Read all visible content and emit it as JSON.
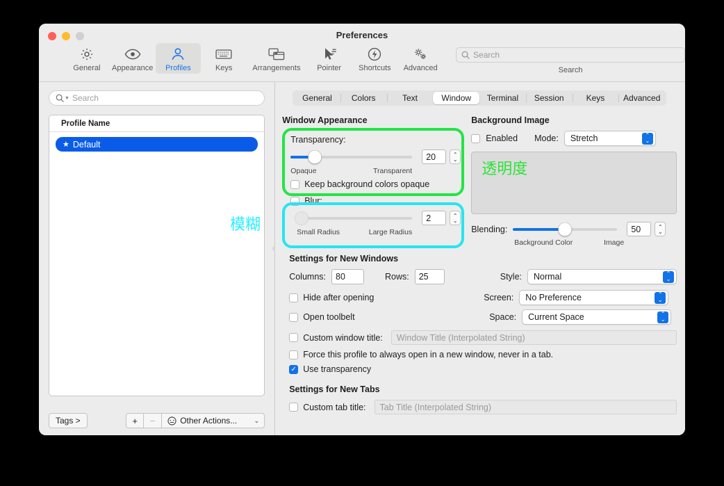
{
  "window": {
    "title": "Preferences"
  },
  "toolbar": {
    "items": [
      {
        "label": "General",
        "icon": "gear-icon",
        "selected": false
      },
      {
        "label": "Appearance",
        "icon": "eye-icon",
        "selected": false
      },
      {
        "label": "Profiles",
        "icon": "person-icon",
        "selected": true
      },
      {
        "label": "Keys",
        "icon": "keyboard-icon",
        "selected": false
      },
      {
        "label": "Arrangements",
        "icon": "windows-icon",
        "selected": false
      },
      {
        "label": "Pointer",
        "icon": "cursor-icon",
        "selected": false
      },
      {
        "label": "Shortcuts",
        "icon": "bolt-icon",
        "selected": false
      },
      {
        "label": "Advanced",
        "icon": "gears-icon",
        "selected": false
      }
    ],
    "search": {
      "placeholder": "Search",
      "value": "",
      "caption": "Search",
      "icon": "search-icon"
    }
  },
  "sidebar": {
    "search": {
      "placeholder": "Search",
      "value": "",
      "icon": "search-icon"
    },
    "list_header": "Profile Name",
    "profiles": [
      {
        "name": "Default",
        "starred": true,
        "selected": true
      }
    ],
    "footer": {
      "tags_label": "Tags >",
      "add_label": "+",
      "remove_label": "−",
      "actions_label": "Other Actions...",
      "actions_icon": "ellipsis-circle-icon"
    }
  },
  "main": {
    "tabs": [
      {
        "label": "General",
        "active": false
      },
      {
        "label": "Colors",
        "active": false
      },
      {
        "label": "Text",
        "active": false
      },
      {
        "label": "Window",
        "active": true
      },
      {
        "label": "Terminal",
        "active": false
      },
      {
        "label": "Session",
        "active": false
      },
      {
        "label": "Keys",
        "active": false
      },
      {
        "label": "Advanced",
        "active": false
      }
    ],
    "window_appearance": {
      "title": "Window Appearance",
      "transparency": {
        "label": "Transparency:",
        "value": "20",
        "min_label": "Opaque",
        "max_label": "Transparent",
        "percent": 20
      },
      "keep_bg_opaque": {
        "label": "Keep background colors opaque",
        "checked": false
      },
      "blur": {
        "label": "Blur:",
        "checked": false,
        "value": "2",
        "min_label": "Small Radius",
        "max_label": "Large Radius",
        "percent": 4
      }
    },
    "background_image": {
      "title": "Background Image",
      "enabled": {
        "label": "Enabled",
        "checked": false
      },
      "mode": {
        "label": "Mode:",
        "value": "Stretch"
      },
      "preview_text": "透明度",
      "blending": {
        "label": "Blending:",
        "value": "50",
        "min_label": "Background Color",
        "max_label": "Image",
        "percent": 50
      }
    },
    "new_windows": {
      "title": "Settings for New Windows",
      "columns": {
        "label": "Columns:",
        "value": "80"
      },
      "rows": {
        "label": "Rows:",
        "value": "25"
      },
      "hide_after_opening": {
        "label": "Hide after opening",
        "checked": false
      },
      "open_toolbelt": {
        "label": "Open toolbelt",
        "checked": false
      },
      "custom_window_title": {
        "label": "Custom window title:",
        "checked": false,
        "placeholder": "Window Title (Interpolated String)",
        "value": ""
      },
      "force_new_window": {
        "label": "Force this profile to always open in a new window, never in a tab.",
        "checked": false
      },
      "use_transparency": {
        "label": "Use transparency",
        "checked": true
      },
      "style": {
        "label": "Style:",
        "value": "Normal"
      },
      "screen": {
        "label": "Screen:",
        "value": "No Preference"
      },
      "space": {
        "label": "Space:",
        "value": "Current Space"
      }
    },
    "new_tabs": {
      "title": "Settings for New Tabs",
      "custom_tab_title": {
        "label": "Custom tab title:",
        "checked": false,
        "placeholder": "Tab Title (Interpolated String)",
        "value": ""
      }
    }
  },
  "annotations": {
    "blur_cjk_label": "模糊",
    "green_highlight_color": "#22e546",
    "cyan_highlight_color": "#27e5f0",
    "green_text_color": "#2fe23a",
    "cyan_text_color": "#28f0ff"
  }
}
